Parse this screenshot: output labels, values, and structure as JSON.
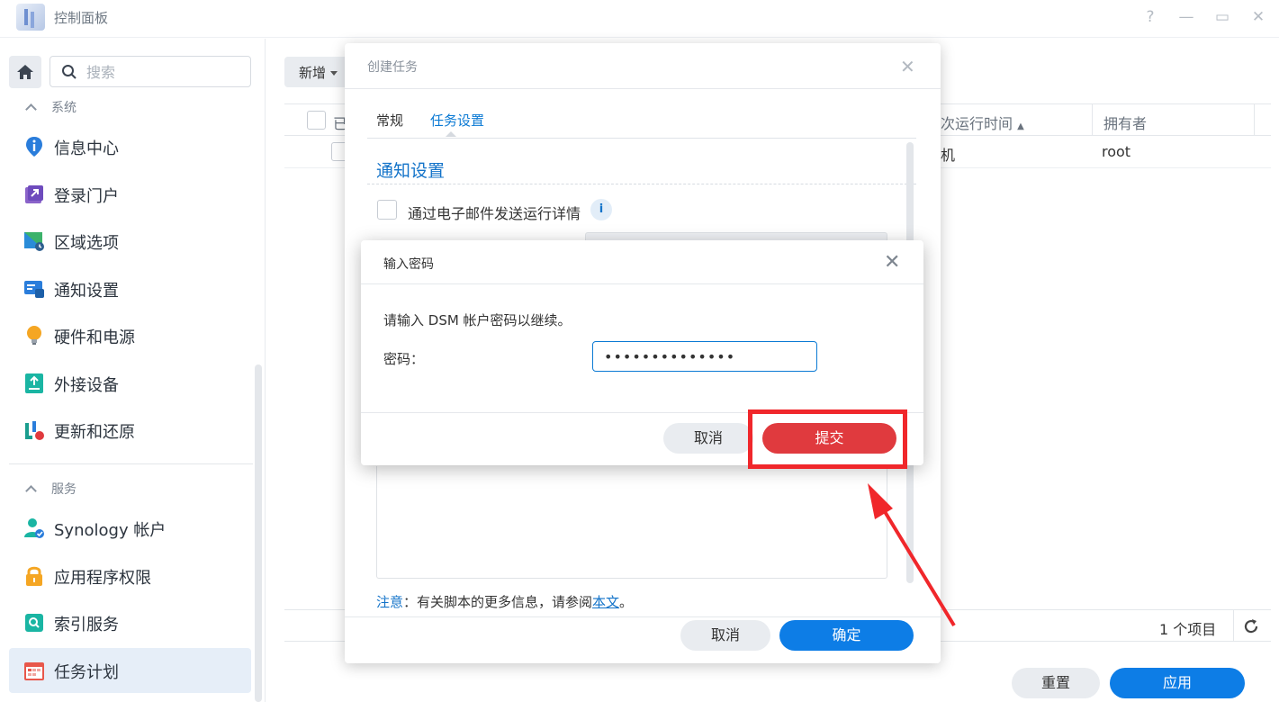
{
  "window": {
    "title": "控制面板",
    "help": "?",
    "minimize": "—",
    "maximize": "▭",
    "close": "✕"
  },
  "sidebar": {
    "search_placeholder": "搜索",
    "section_system": "系统",
    "section_services": "服务",
    "items": [
      {
        "label": "信息中心",
        "icon": "info-center-icon"
      },
      {
        "label": "登录门户",
        "icon": "login-portal-icon"
      },
      {
        "label": "区域选项",
        "icon": "regional-options-icon"
      },
      {
        "label": "通知设置",
        "icon": "notification-icon"
      },
      {
        "label": "硬件和电源",
        "icon": "hardware-power-icon"
      },
      {
        "label": "外接设备",
        "icon": "external-devices-icon"
      },
      {
        "label": "更新和还原",
        "icon": "update-restore-icon"
      },
      {
        "label": "Synology 帐户",
        "icon": "synology-account-icon"
      },
      {
        "label": "应用程序权限",
        "icon": "app-privileges-icon"
      },
      {
        "label": "索引服务",
        "icon": "indexing-service-icon"
      },
      {
        "label": "任务计划",
        "icon": "task-scheduler-icon"
      }
    ]
  },
  "main": {
    "create_button": "新增",
    "columns": {
      "enabled": "已",
      "next_run": "次运行时间",
      "owner": "拥有者"
    },
    "row": {
      "next_run": "机",
      "owner": "root"
    },
    "item_count": "1 个项目",
    "reset_button": "重置",
    "apply_button": "应用"
  },
  "create_dialog": {
    "title": "创建任务",
    "tabs": {
      "general": "常规",
      "settings": "任务设置"
    },
    "section_title": "通知设置",
    "email_label": "通过电子邮件发送运行详情",
    "info_glyph": "i",
    "note_label": "注意",
    "note_text": "：有关脚本的更多信息，请参阅",
    "note_link": "本文",
    "note_end": "。",
    "cancel_button": "取消",
    "ok_button": "确定",
    "close": "✕"
  },
  "password_dialog": {
    "title": "输入密码",
    "prompt": "请输入 DSM 帐户密码以继续。",
    "label": "密码：",
    "value": "••••••••••••••",
    "cancel_button": "取消",
    "submit_button": "提交",
    "close": "✕"
  },
  "colors": {
    "accent": "#0d7de6",
    "danger": "#e03a3e",
    "annotation": "#f0272b"
  }
}
